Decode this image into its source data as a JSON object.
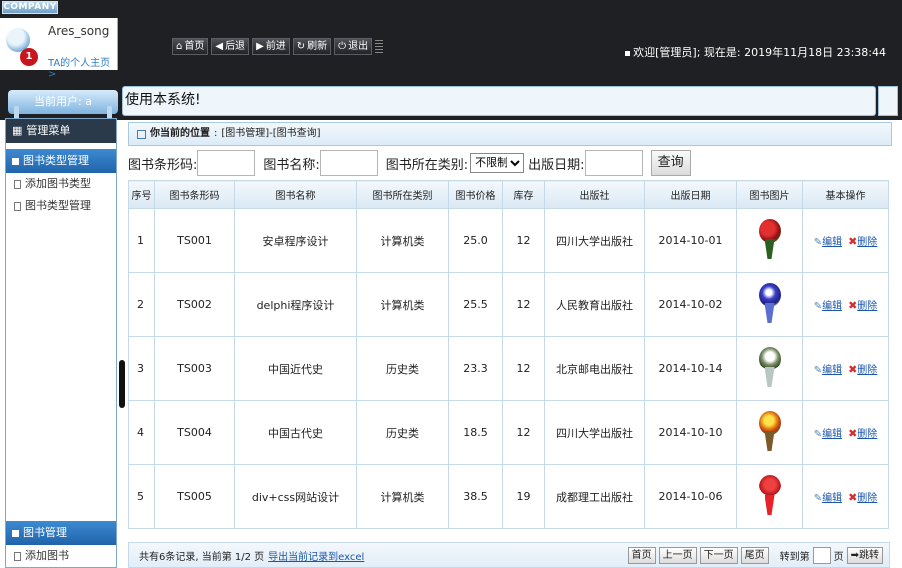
{
  "header": {
    "brand": "COMPANY",
    "user_name": "Ares_song",
    "badge_count": "1",
    "home_link": "TA的个人主页 >",
    "nav": [
      {
        "icon": "home-icon",
        "glyph": "⌂",
        "label": "首页"
      },
      {
        "icon": "back-icon",
        "glyph": "◀",
        "label": "后退"
      },
      {
        "icon": "forward-icon",
        "glyph": "▶",
        "label": "前进"
      },
      {
        "icon": "refresh-icon",
        "glyph": "↻",
        "label": "刷新"
      },
      {
        "icon": "logout-icon",
        "glyph": "⏻",
        "label": "退出"
      }
    ],
    "welcome": "欢迎[管理员]; 现在是: 2019年11月18日 23:38:44"
  },
  "subbar": {
    "current_user": "当前用户: a",
    "notice": "使用本系统!"
  },
  "sidebar": {
    "title": "管理菜单",
    "sections": [
      {
        "label": "图书类型管理",
        "items": [
          "添加图书类型",
          "图书类型管理"
        ]
      },
      {
        "label": "图书管理",
        "items": [
          "添加图书"
        ]
      }
    ]
  },
  "location": {
    "label": "你当前的位置",
    "path": "[图书管理]-[图书查询]"
  },
  "search": {
    "barcode_label": "图书条形码:",
    "barcode_value": "",
    "name_label": "图书名称:",
    "name_value": "",
    "category_label": "图书所在类别:",
    "category_value": "不限制",
    "date_label": "出版日期:",
    "date_value": "",
    "query_button": "查询"
  },
  "table": {
    "headers": [
      "序号",
      "图书条形码",
      "图书名称",
      "图书所在类别",
      "图书价格",
      "库存",
      "出版社",
      "出版日期",
      "图书图片",
      "基本操作"
    ],
    "edit_label": "编辑",
    "delete_label": "删除",
    "rows": [
      {
        "seq": "1",
        "barcode": "TS001",
        "name": "安卓程序设计",
        "category": "计算机类",
        "price": "25.0",
        "stock": "12",
        "publisher": "四川大学出版社",
        "date": "2014-10-01",
        "image": "red-rose-bouquet"
      },
      {
        "seq": "2",
        "barcode": "TS002",
        "name": "delphi程序设计",
        "category": "计算机类",
        "price": "25.5",
        "stock": "12",
        "publisher": "人民教育出版社",
        "date": "2014-10-02",
        "image": "blue-flower-bouquet"
      },
      {
        "seq": "3",
        "barcode": "TS003",
        "name": "中国近代史",
        "category": "历史类",
        "price": "23.3",
        "stock": "12",
        "publisher": "北京邮电出版社",
        "date": "2014-10-14",
        "image": "white-flower-vase"
      },
      {
        "seq": "4",
        "barcode": "TS004",
        "name": "中国古代史",
        "category": "历史类",
        "price": "18.5",
        "stock": "12",
        "publisher": "四川大学出版社",
        "date": "2014-10-10",
        "image": "yellow-flower-basket"
      },
      {
        "seq": "5",
        "barcode": "TS005",
        "name": "div+css网站设计",
        "category": "计算机类",
        "price": "38.5",
        "stock": "19",
        "publisher": "成都理工出版社",
        "date": "2014-10-06",
        "image": "red-rose-wrap"
      }
    ]
  },
  "footer": {
    "summary": "共有6条记录, 当前第 1/2 页",
    "export_link": "导出当前记录到excel",
    "first_page": "首页",
    "prev_page": "上一页",
    "next_page": "下一页",
    "last_page": "尾页",
    "goto_label": "转到第",
    "page_suffix": "页",
    "goto_button": "跳转"
  },
  "colors": {
    "header_bg": "#1f2024",
    "accent_blue": "#1f64ab",
    "link_blue": "#1b56a9",
    "delete_red": "#d62b2b",
    "badge_red": "#c9151b"
  }
}
